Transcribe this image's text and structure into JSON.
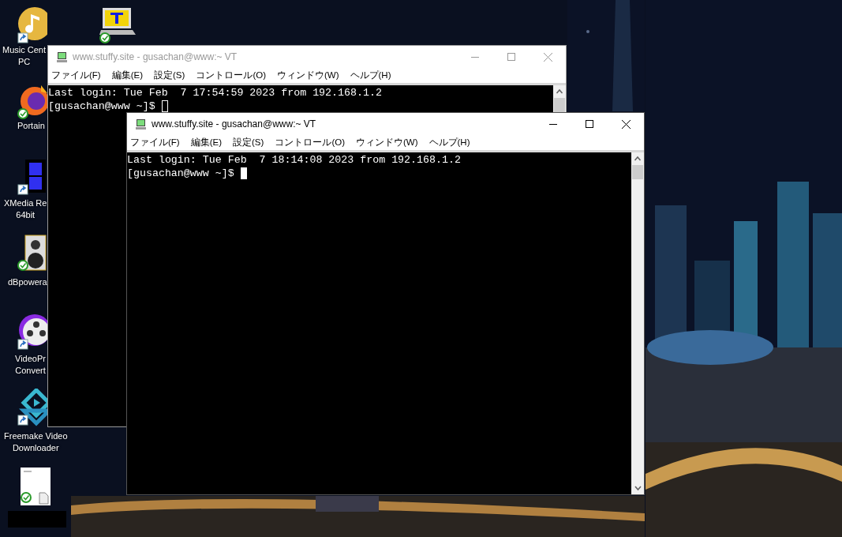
{
  "desktop_icons": [
    {
      "kind": "music",
      "lines": [
        "Music Cent",
        "PC"
      ]
    },
    {
      "kind": "terminal"
    },
    {
      "kind": "browser",
      "lines": [
        "Portain"
      ]
    },
    {
      "kind": "film",
      "lines": [
        "XMedia Re",
        "64bit"
      ]
    },
    {
      "kind": "speaker",
      "lines": [
        "dBpowera"
      ]
    },
    {
      "kind": "reel",
      "lines": [
        "VideoPr",
        "Convert"
      ]
    },
    {
      "kind": "download",
      "lines": [
        "Freemake Video",
        "Downloader"
      ]
    },
    {
      "kind": "document"
    }
  ],
  "windows": [
    {
      "title": "www.stuffy.site - gusachan@www:~ VT",
      "active": false,
      "menu": [
        "ファイル(F)",
        "編集(E)",
        "設定(S)",
        "コントロール(O)",
        "ウィンドウ(W)",
        "ヘルプ(H)"
      ],
      "terminal": [
        "Last login: Tue Feb  7 17:54:59 2023 from 192.168.1.2",
        "[gusachan@www ~]$ "
      ]
    },
    {
      "title": "www.stuffy.site - gusachan@www:~ VT",
      "active": true,
      "menu": [
        "ファイル(F)",
        "編集(E)",
        "設定(S)",
        "コントロール(O)",
        "ウィンドウ(W)",
        "ヘルプ(H)"
      ],
      "terminal": [
        "Last login: Tue Feb  7 18:14:08 2023 from 192.168.1.2",
        "[gusachan@www ~]$ "
      ]
    }
  ]
}
